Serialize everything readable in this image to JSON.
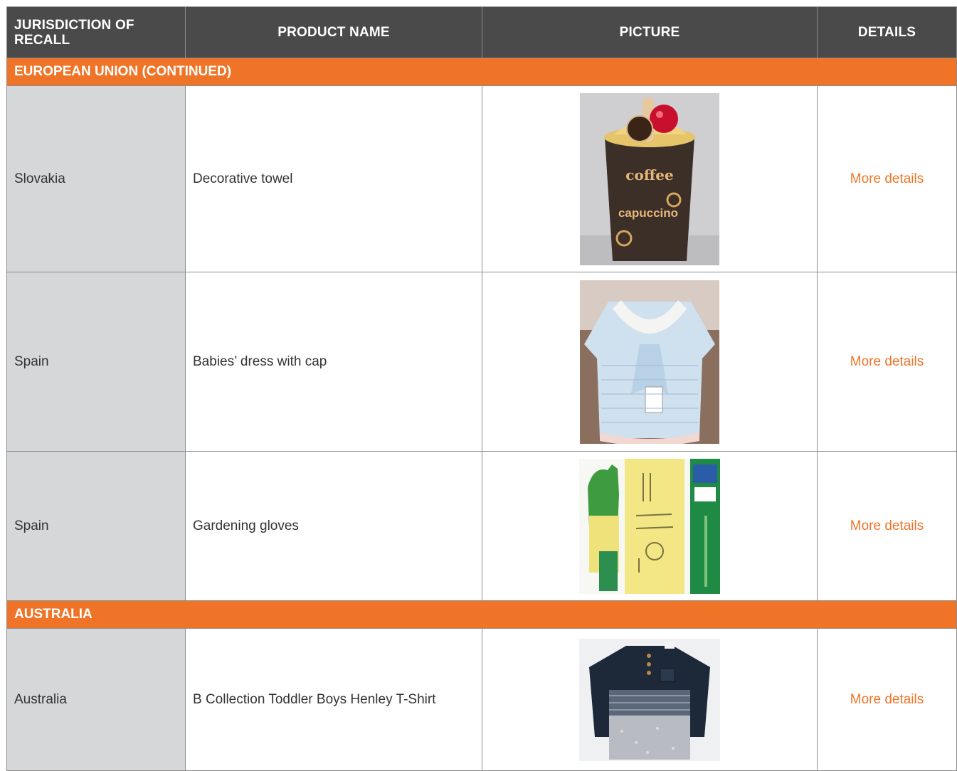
{
  "headers": {
    "jurisdiction": "JURISDICTION OF RECALL",
    "product": "PRODUCT NAME",
    "picture": "PICTURE",
    "details": "DETAILS"
  },
  "sections": [
    {
      "title": "EUROPEAN UNION (CONTINUED)",
      "rows": [
        {
          "jurisdiction": "Slovakia",
          "product": "Decorative towel",
          "details": "More details",
          "picture_text": [
            "coffee",
            "capuccino"
          ]
        },
        {
          "jurisdiction": "Spain",
          "product": "Babies’ dress with cap",
          "details": "More details"
        },
        {
          "jurisdiction": "Spain",
          "product": "Gardening gloves",
          "details": "More details"
        }
      ]
    },
    {
      "title": "AUSTRALIA",
      "rows": [
        {
          "jurisdiction": "Australia",
          "product": "B Collection Toddler Boys Henley T-Shirt",
          "details": "More details"
        }
      ]
    }
  ],
  "colors": {
    "header_bg": "#4a4a4a",
    "accent": "#f07427",
    "jurisdiction_bg": "#d6d7d9"
  }
}
